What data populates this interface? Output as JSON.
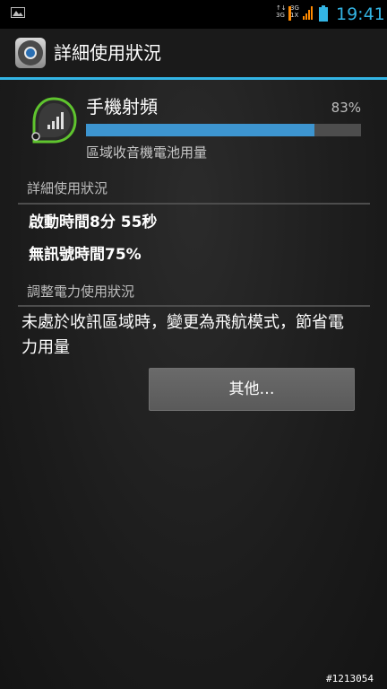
{
  "status_bar": {
    "net_label_1": "↑↓",
    "net_label_2": "3G",
    "data_label_1": "3G",
    "data_label_2": "1X",
    "time": "19:41",
    "accent_color": "#33b5e5",
    "signal_color": "#ff8a00"
  },
  "action_bar": {
    "icon": "settings-gear-icon",
    "title": "詳細使用狀況"
  },
  "battery_item": {
    "icon": "cell-signal-icon",
    "name": "手機射頻",
    "percent_label": "83%",
    "percent_value": 83,
    "subtitle": "區域收音機電池用量"
  },
  "usage_section": {
    "header": "詳細使用狀況",
    "rows": [
      {
        "label": "啟動時間",
        "value": "8分 55秒"
      },
      {
        "label": "無訊號時間",
        "value": "75%"
      }
    ]
  },
  "adjust_section": {
    "header": "調整電力使用狀況",
    "suggestion": "未處於收訊區域時，變更為飛航模式，節省電力用量",
    "button_label": "其他…"
  },
  "watermark": "#1213054"
}
